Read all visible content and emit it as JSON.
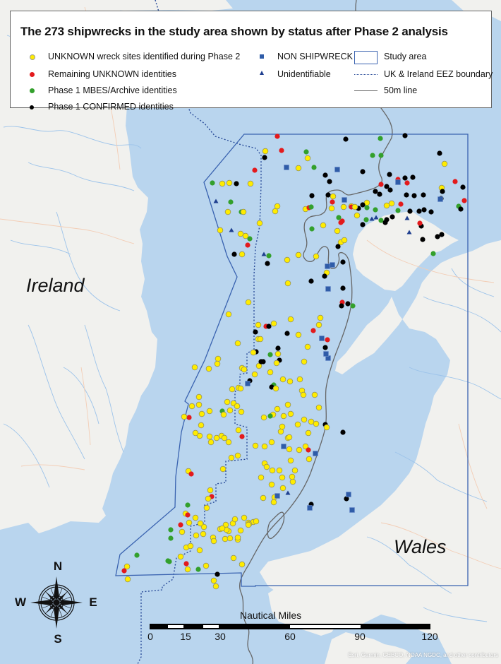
{
  "legend": {
    "title": "The 273 shipwrecks in the study area shown by status after Phase 2 analysis",
    "items": [
      {
        "label": "UNKNOWN wreck sites identified during Phase 2",
        "symbol": "circle",
        "color": "#ffec00"
      },
      {
        "label": "Remaining UNKNOWN identities",
        "symbol": "circle",
        "color": "#e31a1c"
      },
      {
        "label": "Phase 1 MBES/Archive identities",
        "symbol": "circle",
        "color": "#33a02c"
      },
      {
        "label": "Phase 1 CONFIRMED identities",
        "symbol": "circle",
        "color": "#000000"
      },
      {
        "label": "NON SHIPWRECK",
        "symbol": "square",
        "color": "#2f5ca8"
      },
      {
        "label": "Unidentifiable",
        "symbol": "triangle",
        "color": "#1f3f8f"
      },
      {
        "label": "Study area",
        "symbol": "rectangle-outline",
        "color": "#3a63b0"
      },
      {
        "label": "UK & Ireland EEZ boundary",
        "symbol": "dotted-line",
        "color": "#2b4d9a"
      },
      {
        "label": "50m line",
        "symbol": "solid-line",
        "color": "#666666"
      }
    ]
  },
  "map": {
    "labels": {
      "ireland": "Ireland",
      "wales": "Wales"
    },
    "colors": {
      "sea": "#b9d5ee",
      "land": "#f1f1ee",
      "study_area": "#3a63b0",
      "eez": "#2b4d9a",
      "depth_line": "#666666",
      "river": "#9cc3ea",
      "road": "#f3cdb5"
    },
    "total_wrecks": 273
  },
  "compass": {
    "n": "N",
    "s": "S",
    "e": "E",
    "w": "W"
  },
  "scale_bar": {
    "title": "Nautical Miles",
    "ticks": [
      "0",
      "15",
      "30",
      "60",
      "90",
      "120"
    ]
  },
  "attribution": "Esri, Garmin, GEBCO, NOAA NGDC, and other contributors"
}
